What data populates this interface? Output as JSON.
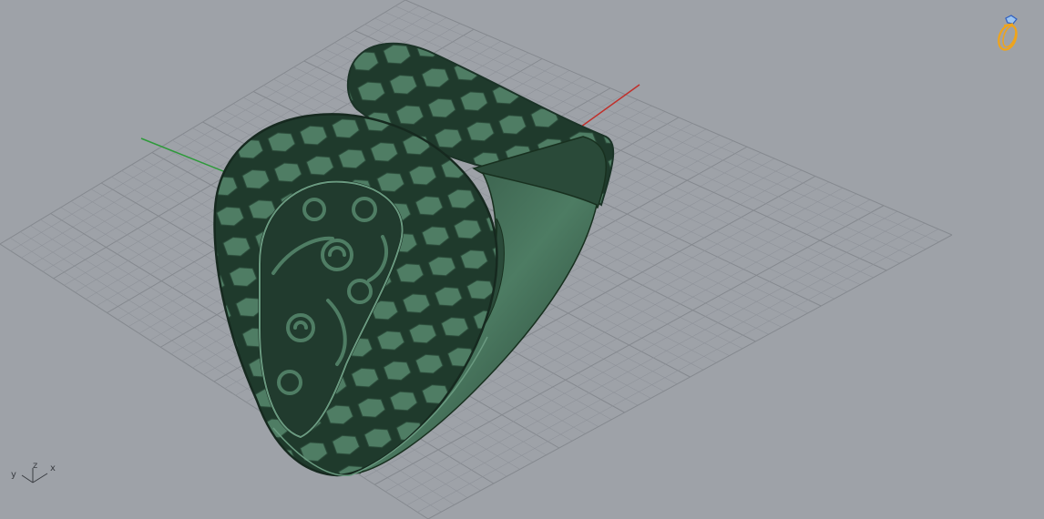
{
  "viewport": {
    "background": "#9ea2a8",
    "grid_color": "#8f939a",
    "grid_major_color": "#85898f",
    "x_axis_color": "#c0302b",
    "y_axis_color": "#2e9a3a",
    "model_color": "#3d6a52"
  },
  "axes_widget": {
    "x": "x",
    "y": "y",
    "z": "z"
  },
  "logo": {
    "icon": "ring-logo-icon"
  }
}
